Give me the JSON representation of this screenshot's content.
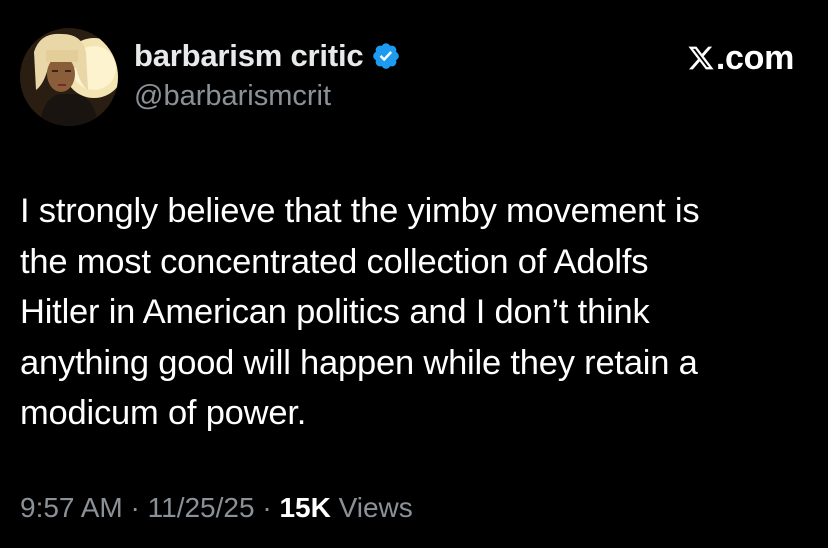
{
  "author": {
    "display_name": "barbarism critic",
    "handle": "@barbarismcrit",
    "verified": true,
    "verified_icon": "verified-badge-icon",
    "verified_color": "#1d9bf0"
  },
  "brand": {
    "icon": "x-logo-icon",
    "suffix": ".com"
  },
  "tweet": {
    "text": "I strongly believe that the yimby movement is\nthe most concentrated collection of Adolfs\nHitler in American politics and I don’t think\nanything good will happen while they retain a\nmodicum of power."
  },
  "meta": {
    "time": "9:57 AM",
    "separator": "·",
    "date": "11/25/25",
    "views_count": "15K",
    "views_label": "Views"
  },
  "colors": {
    "background": "#000000",
    "text_primary": "#ffffff",
    "text_secondary": "#8b9196"
  }
}
